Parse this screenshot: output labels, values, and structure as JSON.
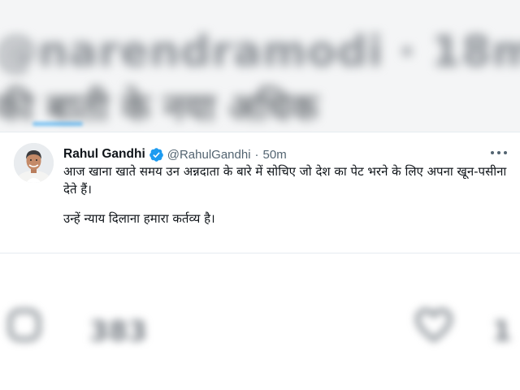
{
  "tweet": {
    "display_name": "Rahul Gandhi",
    "handle": "@RahulGandhi",
    "separator": "·",
    "time": "50m",
    "paragraphs": [
      "आज खाना खाते समय उन अन्नदाता के बारे में सोचिए जो देश का पेट भरने के लिए अपना खून-पसीना देते हैं।",
      "उन्हें न्याय दिलाना हमारा कर्तव्य है।"
    ],
    "avatar_icon": "profile-photo",
    "verified_icon": "verified-badge-icon",
    "more_icon": "more-options-icon"
  },
  "blurred_context": {
    "top_line": "@narendramodi · 18m",
    "second_line": "की बाती के नया अधिक",
    "bottom_left_count": "383",
    "bottom_right_count": "1"
  },
  "colors": {
    "accent": "#1d9bf0",
    "text_primary": "#0f1419",
    "text_secondary": "#536471",
    "border": "#e6ecf0"
  }
}
